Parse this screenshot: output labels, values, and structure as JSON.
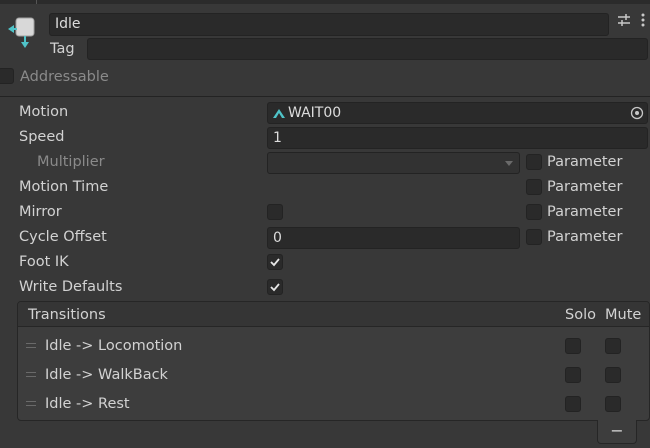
{
  "header": {
    "name_value": "Idle",
    "tag_label": "Tag",
    "tag_value": "",
    "addressable_label": "Addressable"
  },
  "props": {
    "motion_label": "Motion",
    "motion_value": "WAIT00",
    "speed_label": "Speed",
    "speed_value": "1",
    "multiplier_label": "Multiplier",
    "multiplier_value": "",
    "motion_time_label": "Motion Time",
    "mirror_label": "Mirror",
    "cycle_offset_label": "Cycle Offset",
    "cycle_offset_value": "0",
    "foot_ik_label": "Foot IK",
    "write_defaults_label": "Write Defaults",
    "parameter_label": "Parameter"
  },
  "transitions": {
    "header_label": "Transitions",
    "solo_label": "Solo",
    "mute_label": "Mute",
    "rows": [
      {
        "label": "Idle -> Locomotion"
      },
      {
        "label": "Idle -> WalkBack"
      },
      {
        "label": "Idle -> Rest"
      }
    ],
    "remove_label": "−"
  },
  "state": {
    "addressable": false,
    "mirror": false,
    "foot_ik": true,
    "write_defaults": true,
    "multiplier_param": false,
    "motion_time_param": false,
    "mirror_param": false,
    "cycle_offset_param": false
  },
  "colors": {
    "background": "#383838",
    "field": "#2a2a2a",
    "text": "#d2d2d2",
    "motion_icon": "#4fc3c8",
    "state_icon_arrows": "#4fc3c8"
  }
}
